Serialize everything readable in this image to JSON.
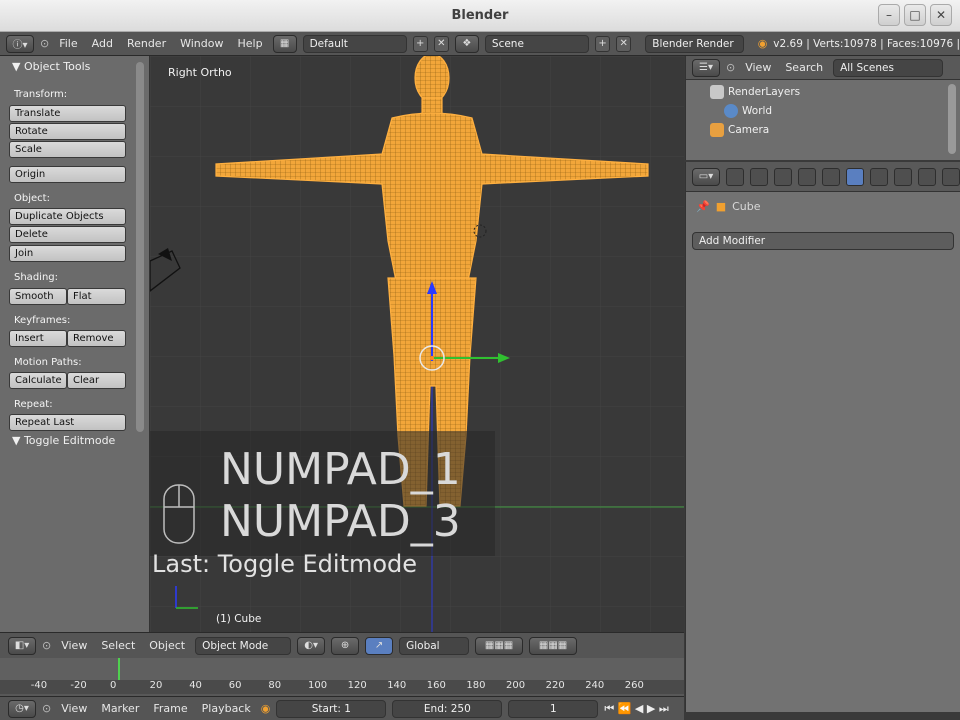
{
  "window": {
    "title": "Blender"
  },
  "info_header": {
    "menus": [
      "File",
      "Add",
      "Render",
      "Window",
      "Help"
    ],
    "screen_layout": "Default",
    "scene": "Scene",
    "render_engine": "Blender Render",
    "stats": "v2.69 | Verts:10978 | Faces:10976 |"
  },
  "tool_shelf": {
    "panel_title": "▼ Object Tools",
    "sections": {
      "transform": "Transform:",
      "object": "Object:",
      "shading": "Shading:",
      "keyframes": "Keyframes:",
      "motion_paths": "Motion Paths:",
      "repeat": "Repeat:"
    },
    "buttons": {
      "translate": "Translate",
      "rotate": "Rotate",
      "scale": "Scale",
      "origin": "Origin",
      "duplicate": "Duplicate Objects",
      "delete": "Delete",
      "join": "Join",
      "smooth": "Smooth",
      "flat": "Flat",
      "insert": "Insert",
      "remove": "Remove",
      "calculate": "Calculate",
      "clear": "Clear",
      "repeat_last": "Repeat Last"
    },
    "operator_panel": "▼ Toggle Editmode"
  },
  "viewport": {
    "view_name": "Right Ortho",
    "active_object": "(1) Cube",
    "key1": "NUMPAD_1",
    "key2": "NUMPAD_3",
    "last_op": "Last: Toggle Editmode"
  },
  "outliner": {
    "menus": [
      "View",
      "Search"
    ],
    "filter": "All Scenes",
    "items": [
      "RenderLayers",
      "World",
      "Camera"
    ]
  },
  "properties": {
    "context_object": "Cube",
    "add_modifier": "Add Modifier"
  },
  "view3d_header": {
    "menus": [
      "View",
      "Select",
      "Object"
    ],
    "mode": "Object Mode",
    "orientation": "Global"
  },
  "timeline": {
    "ruler": [
      "-40",
      "-20",
      "0",
      "20",
      "40",
      "60",
      "80",
      "100",
      "120",
      "140",
      "160",
      "180",
      "200",
      "220",
      "240",
      "260"
    ],
    "current_frame": 0,
    "menus": [
      "View",
      "Marker",
      "Frame",
      "Playback"
    ],
    "start": "Start: 1",
    "end": "End: 250",
    "frame": "1"
  },
  "colors": {
    "mesh": "#f0a030",
    "selection_orange": "#ff9a2a",
    "axis_x": "#b02828",
    "axis_y": "#30b030",
    "axis_z": "#2a3aff",
    "frame_marker": "#4fd04f"
  }
}
